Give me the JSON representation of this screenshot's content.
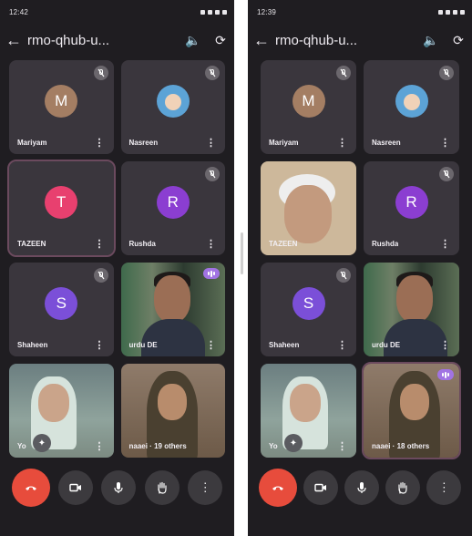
{
  "screens": [
    {
      "status": {
        "time": "12:42"
      },
      "header": {
        "title": "rmo-qhub-u..."
      },
      "tiles": [
        {
          "name": "Mariyam",
          "initial": "M",
          "avatar_color": "#a47e63",
          "type": "avatar",
          "muted": true
        },
        {
          "name": "Nasreen",
          "type": "photo-avatar",
          "muted": true
        },
        {
          "name": "TAZEEN",
          "initial": "T",
          "avatar_color": "#e8406f",
          "type": "avatar",
          "muted": false,
          "active": true
        },
        {
          "name": "Rushda",
          "initial": "R",
          "avatar_color": "#8b3ed1",
          "type": "avatar",
          "muted": true
        },
        {
          "name": "Shaheen",
          "initial": "S",
          "avatar_color": "#7b4fd8",
          "type": "avatar",
          "muted": true
        },
        {
          "name": "urdu DE",
          "type": "photo-man",
          "speaking": true
        },
        {
          "name": "Yo",
          "type": "photo-woman",
          "self": true
        },
        {
          "name": "naaei · 19 others",
          "type": "photo-lady"
        }
      ]
    },
    {
      "status": {
        "time": "12:39"
      },
      "header": {
        "title": "rmo-qhub-u..."
      },
      "tiles": [
        {
          "name": "Mariyam",
          "initial": "M",
          "avatar_color": "#a47e63",
          "type": "avatar",
          "muted": true
        },
        {
          "name": "Nasreen",
          "type": "photo-avatar",
          "muted": true
        },
        {
          "name": "TAZEEN",
          "type": "photo-old",
          "muted": false
        },
        {
          "name": "Rushda",
          "initial": "R",
          "avatar_color": "#8b3ed1",
          "type": "avatar",
          "muted": true
        },
        {
          "name": "Shaheen",
          "initial": "S",
          "avatar_color": "#7b4fd8",
          "type": "avatar",
          "muted": true
        },
        {
          "name": "urdu DE",
          "type": "photo-man"
        },
        {
          "name": "Yo",
          "type": "photo-woman",
          "self": true
        },
        {
          "name": "naaei · 18 others",
          "type": "photo-lady",
          "speaking": true,
          "active": true
        }
      ]
    }
  ],
  "controls": [
    {
      "name": "end-call",
      "icon": "hangup-icon"
    },
    {
      "name": "camera",
      "icon": "camera-icon"
    },
    {
      "name": "mic",
      "icon": "mic-icon"
    },
    {
      "name": "raise-hand",
      "icon": "hand-icon"
    },
    {
      "name": "more-options",
      "icon": "more-vert-icon"
    }
  ]
}
